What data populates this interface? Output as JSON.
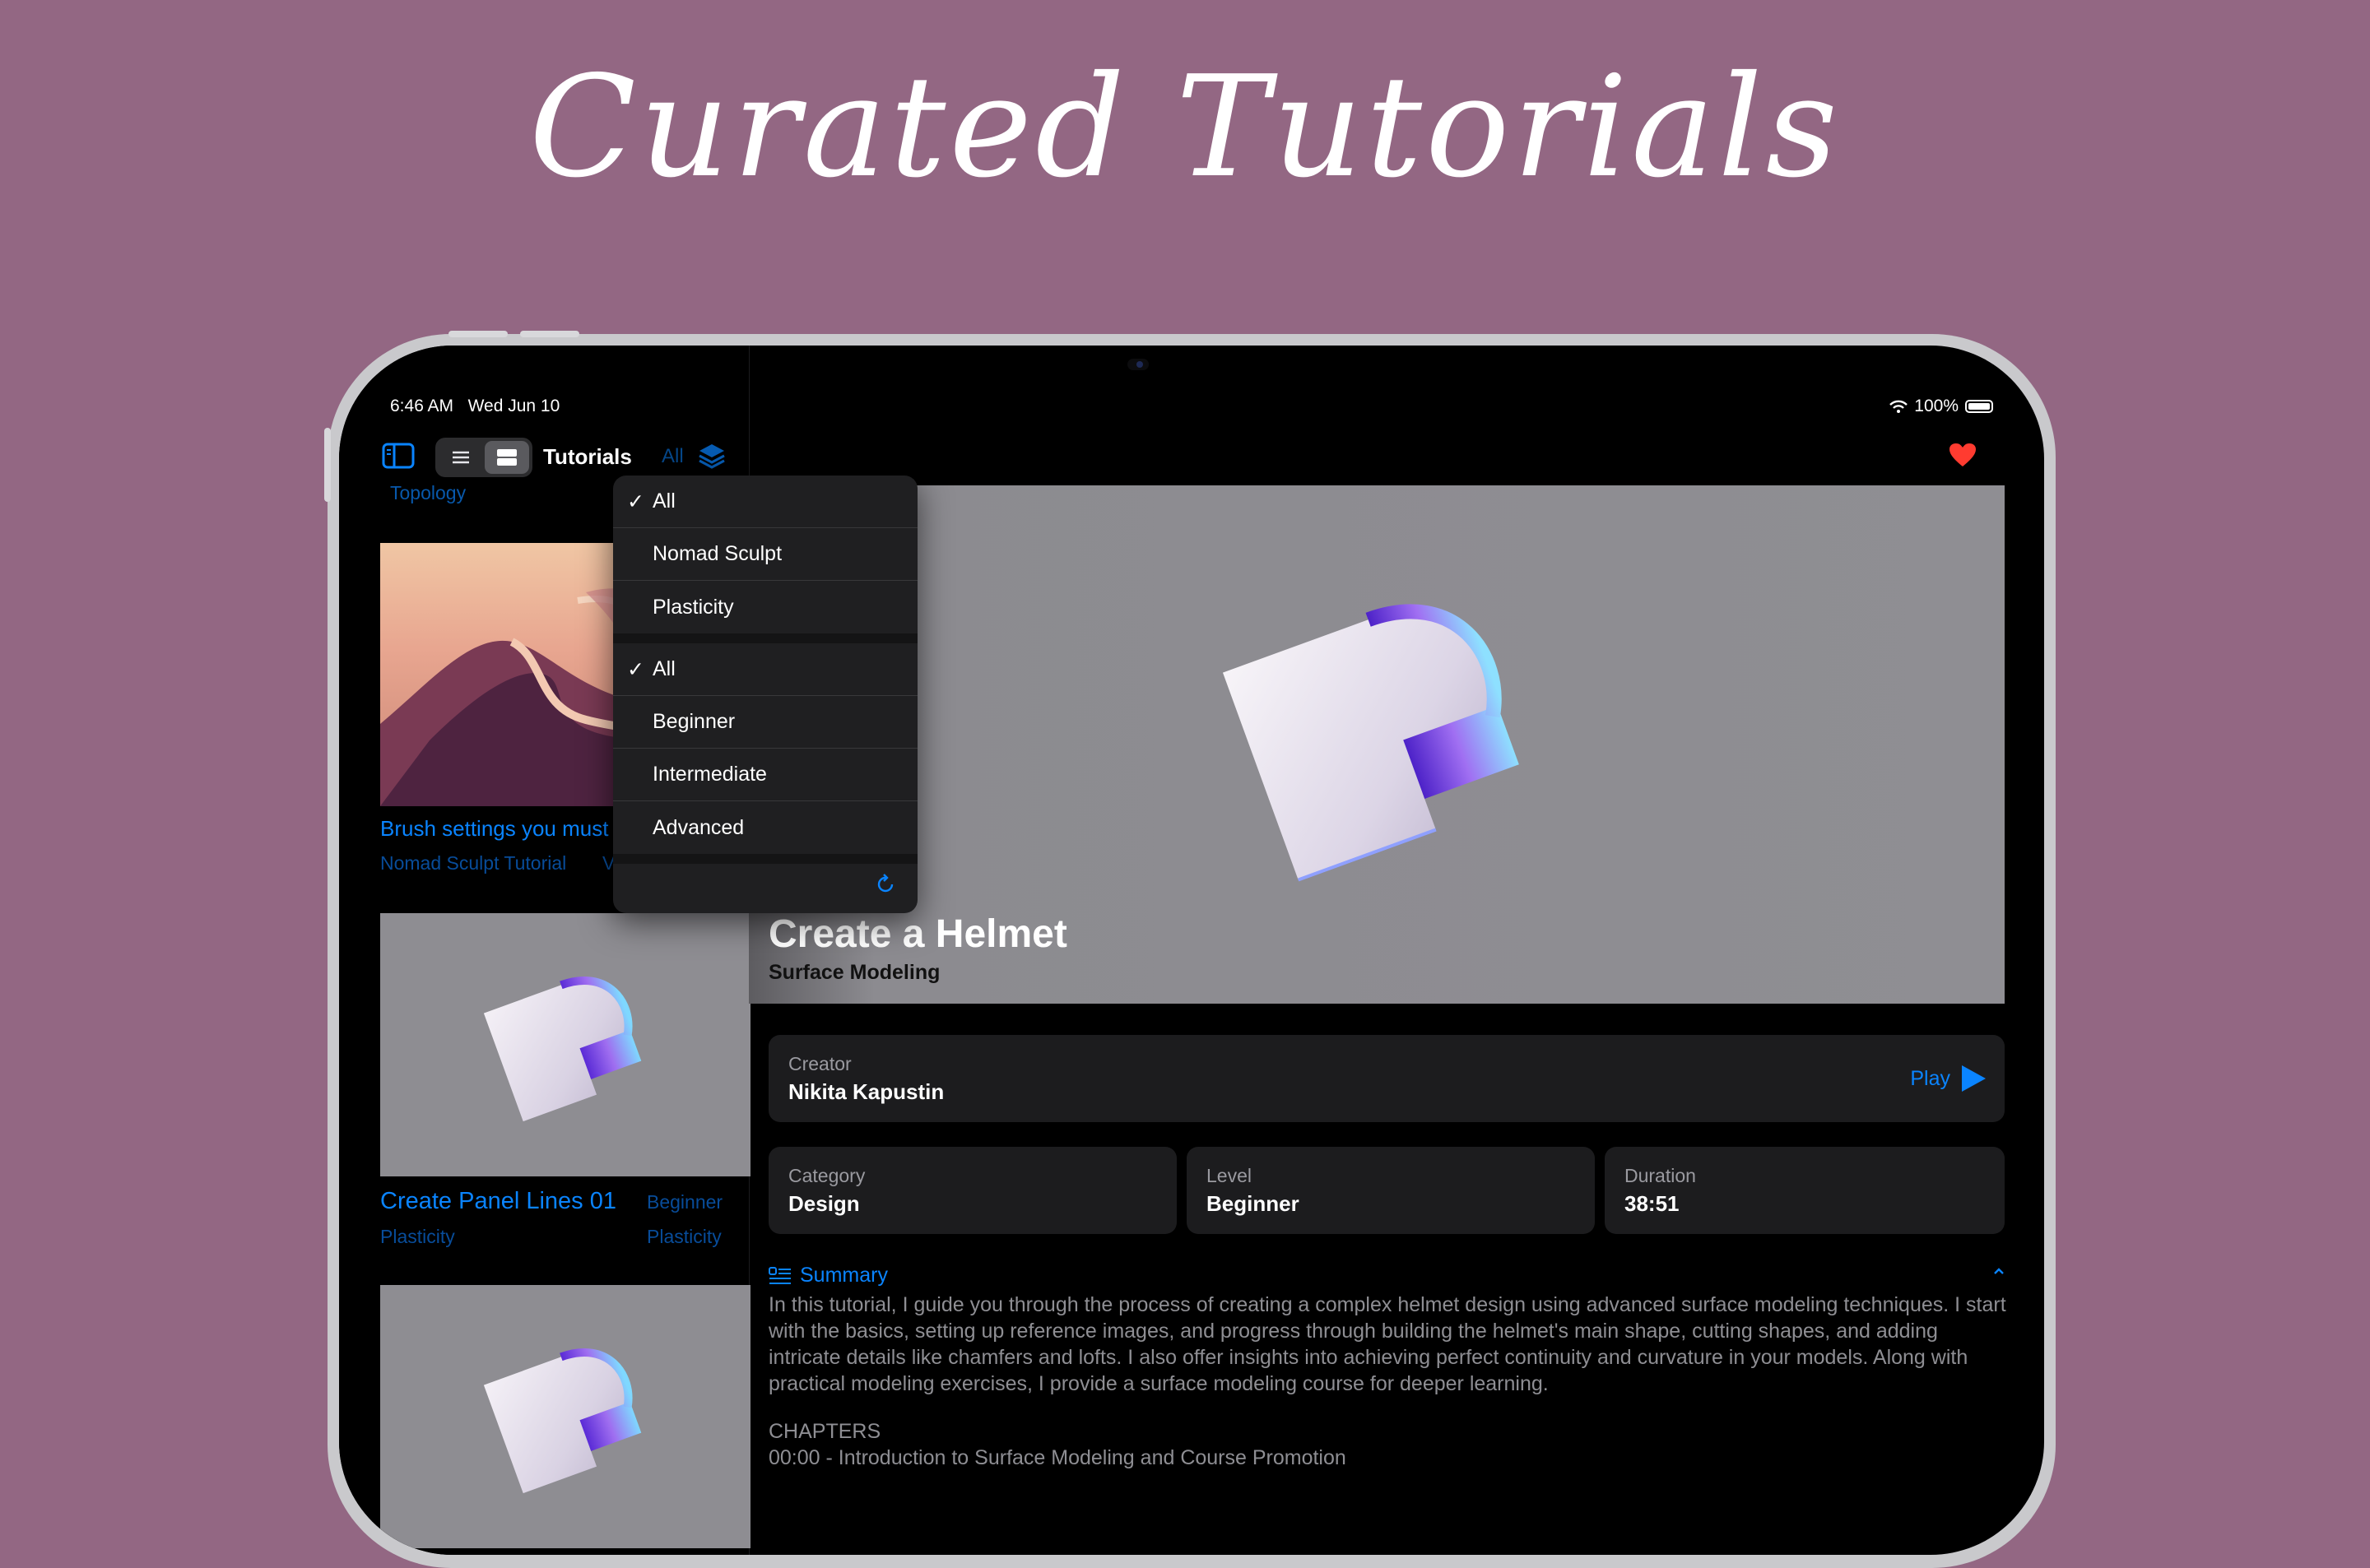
{
  "headline": "Curated Tutorials",
  "status_bar": {
    "time": "6:46 AM",
    "date": "Wed Jun 10",
    "battery": "100%"
  },
  "sidebar": {
    "nav_title": "Tutorials",
    "filter_label": "All",
    "partial_tag": "Topology",
    "cards": [
      {
        "title": "Brush settings you must",
        "subtitle": "Nomad Sculpt Tutorial"
      },
      {
        "title": "Create Panel Lines 01",
        "level": "Beginner",
        "app": "Plasticity",
        "category": "Plasticity"
      }
    ]
  },
  "filter_menu": {
    "software": [
      {
        "label": "All",
        "checked": true
      },
      {
        "label": "Nomad Sculpt",
        "checked": false
      },
      {
        "label": "Plasticity",
        "checked": false
      }
    ],
    "levels": [
      {
        "label": "All",
        "checked": true
      },
      {
        "label": "Beginner",
        "checked": false
      },
      {
        "label": "Intermediate",
        "checked": false
      },
      {
        "label": "Advanced",
        "checked": false
      }
    ],
    "check_glyph": "✓"
  },
  "detail": {
    "title": "Create a Helmet",
    "subtitle": "Surface Modeling",
    "creator": {
      "label": "Creator",
      "value": "Nikita Kapustin",
      "action": "Play"
    },
    "category": {
      "label": "Category",
      "value": "Design"
    },
    "level": {
      "label": "Level",
      "value": "Beginner"
    },
    "duration": {
      "label": "Duration",
      "value": "38:51"
    },
    "summary_label": "Summary",
    "summary": "In this tutorial, I guide you through the process of creating a complex helmet design using advanced surface modeling techniques. I start with the basics, setting up reference images, and progress through building the helmet's main shape, cutting shapes, and adding intricate details like chamfers and lofts. I also offer insights into achieving perfect continuity and curvature in your models. Along with practical modeling exercises, I provide a surface modeling course for deeper learning.",
    "chapters_heading": "CHAPTERS",
    "chapters": [
      "00:00 - Introduction to Surface Modeling and Course Promotion"
    ]
  },
  "colors": {
    "background": "#936783",
    "accent": "#0a84ff",
    "favorite": "#ff3b30"
  },
  "icons": [
    "sidebar-toggle-icon",
    "list-view-icon",
    "card-view-icon",
    "layers-icon",
    "refresh-icon",
    "heart-icon",
    "play-icon",
    "summary-icon",
    "wifi-icon",
    "battery-icon",
    "chevron-icon"
  ]
}
